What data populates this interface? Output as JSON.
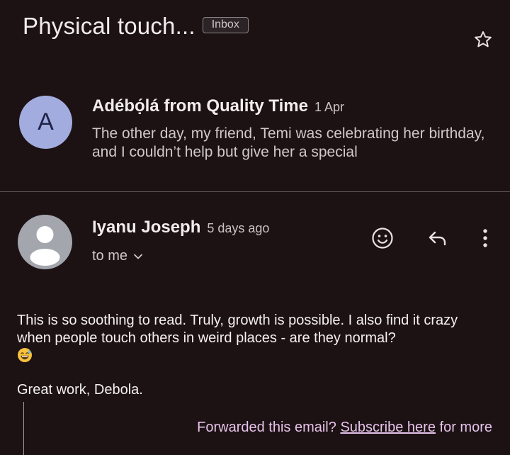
{
  "thread": {
    "subject": "Physical touch...",
    "label": "Inbox"
  },
  "icons": {
    "star": "star-outline-icon",
    "emoji_reaction": "smiley-face-icon",
    "reply": "reply-arrow-icon",
    "more": "more-vertical-icon",
    "expand_recipients": "chevron-down-icon"
  },
  "messages": [
    {
      "avatar_letter": "A",
      "avatar_color": "#a3acdf",
      "sender": "Adébọ́lá from Quality Time",
      "date": "1 Apr",
      "snippet": "The other day, my friend, Temi was celebrating her birthday, and I couldn’t help but give her a special"
    },
    {
      "sender": "Iyanu Joseph",
      "date": "5 days ago",
      "recipients": "to me",
      "body_paragraph": "This is so soothing to read. Truly, growth is possible. I also find it crazy when people touch others in weird places - are they normal?",
      "signoff": "Great work, Debola."
    }
  ],
  "footer": {
    "prefix": "Forwarded this email?",
    "link": "Subscribe here",
    "suffix": "for more"
  },
  "colors": {
    "background": "#1c1214",
    "footer_accent": "#e7c3ea"
  }
}
